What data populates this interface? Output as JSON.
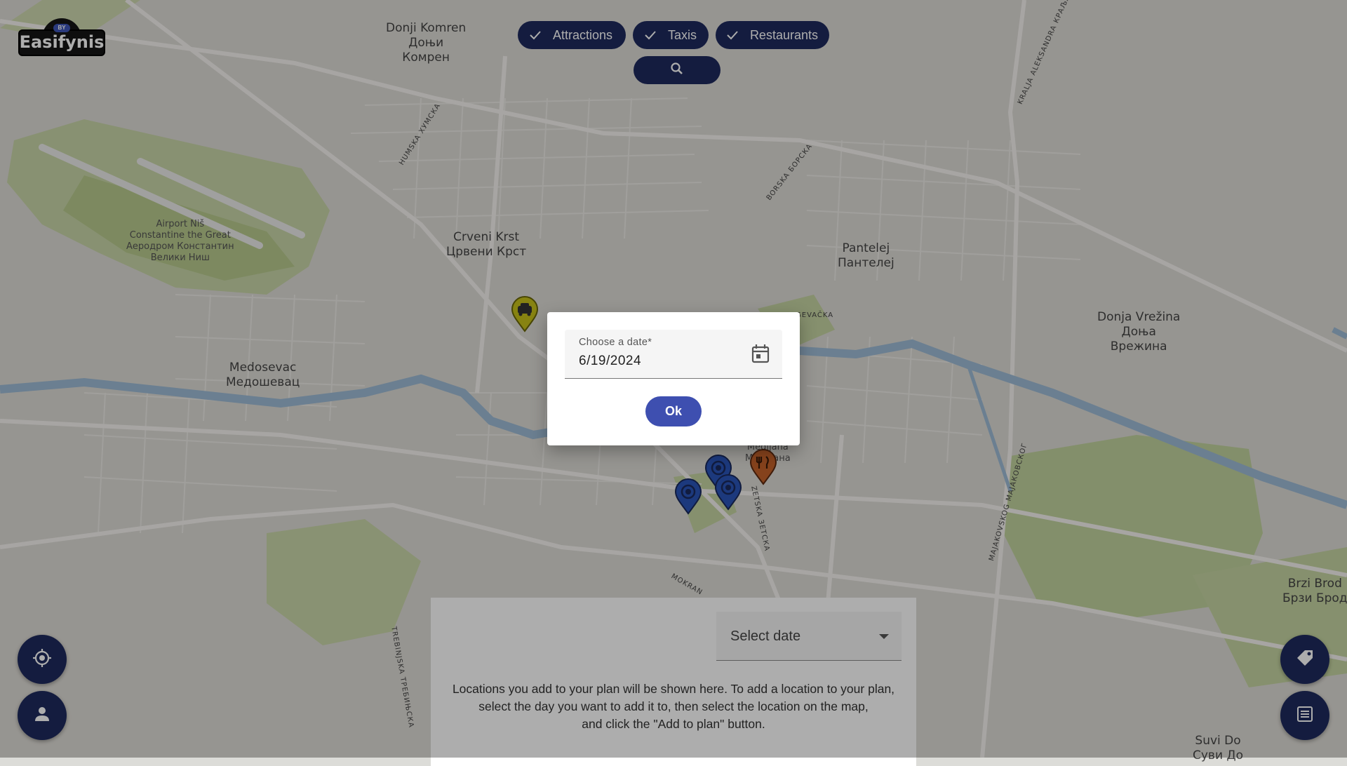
{
  "app": {
    "logo_text": "Easifynis",
    "logo_badge": "BY"
  },
  "filters": [
    {
      "label": "Attractions",
      "checked": true
    },
    {
      "label": "Taxis",
      "checked": true
    },
    {
      "label": "Restaurants",
      "checked": true
    }
  ],
  "search": {
    "icon": "search-icon"
  },
  "map": {
    "places": [
      {
        "text": "Donji Komren\nДоњи\nКомрен"
      },
      {
        "text": "Crveni Krst\nЦрвени Крст"
      },
      {
        "text": "Airport Niš\nConstantine the Great\nАеродром Константин\nВелики Ниш"
      },
      {
        "text": "Pantelej\nПантелеј"
      },
      {
        "text": "Donja Vrežina\nДоња\nВрежина"
      },
      {
        "text": "Medosevac\nМедошевац"
      },
      {
        "text": "Medijana\nМедијана"
      },
      {
        "text": "Brzi Brod\nБрзи Брод"
      },
      {
        "text": "Suvi Do\nСуви До"
      }
    ],
    "roads": [
      {
        "text": "HUMSKA ХУМСКА"
      },
      {
        "text": "BORSKA БОРСКА"
      },
      {
        "text": "KRALJA ALEKSANDRA КРАЉА А"
      },
      {
        "text": "MAJAKOVSKOG МАЈАКОВСКОГ"
      },
      {
        "text": "TREBINJSKA ТРЕБИЊСКА"
      },
      {
        "text": "GEVAČKA"
      },
      {
        "text": "MOKRAN"
      },
      {
        "text": "ZETSKA ЗЕТСКА"
      }
    ]
  },
  "dialog": {
    "date_label": "Choose a date*",
    "date_value": "6/19/2024",
    "ok_label": "Ok"
  },
  "plan_panel": {
    "select_placeholder": "Select date",
    "help_text_1": "Locations you add to your plan will be shown here. To add a location to your plan,",
    "help_text_2": "select the day you want to add it to, then select the location on the map,",
    "help_text_3": "and click the \"Add to plan\" button."
  },
  "fabs": {
    "locate": "crosshair-icon",
    "account": "person-icon",
    "tags": "tag-icon",
    "list": "list-icon"
  },
  "colors": {
    "chip_bg": "#1e2a5e",
    "ok_button": "#3e4fb0",
    "taxi_marker": "#c8c11a",
    "attraction_marker": "#2a54b8",
    "restaurant_marker": "#c4622a"
  }
}
